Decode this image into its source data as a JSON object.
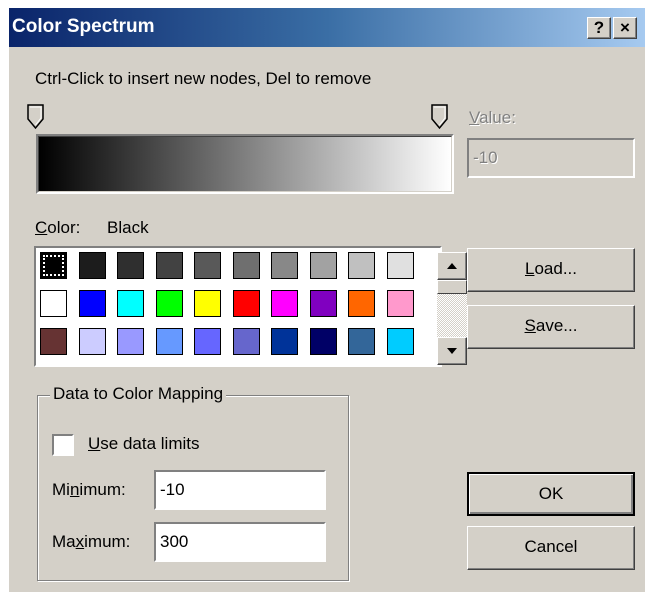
{
  "window": {
    "title": "Color Spectrum",
    "help_button": "?",
    "close_button": "×"
  },
  "instructions": "Ctrl-Click to insert new nodes, Del to remove",
  "gradient": {
    "start_color": "#000000",
    "end_color": "#ffffff"
  },
  "value": {
    "label_pre": "",
    "label_underlined": "V",
    "label_post": "alue:",
    "field_value": "-10"
  },
  "color": {
    "label_underlined": "C",
    "label_post": "olor:",
    "current_value": "Black"
  },
  "palette": [
    [
      "#000000",
      "#1c1c1c",
      "#2f2f2f",
      "#424242",
      "#595959",
      "#6f6f6f",
      "#888888",
      "#a2a2a2",
      "#c0c0c0",
      "#e0e0e0"
    ],
    [
      "#ffffff",
      "#0000ff",
      "#00ffff",
      "#00ff00",
      "#ffff00",
      "#ff0000",
      "#ff00ff",
      "#8000c0",
      "#ff6600",
      "#ff99cc"
    ],
    [
      "#663333",
      "#ccccff",
      "#9999ff",
      "#6699ff",
      "#6666ff",
      "#6666cc",
      "#003399",
      "#000066",
      "#336699",
      "#00ccff"
    ]
  ],
  "selected_swatch": "#000000",
  "buttons": {
    "load_underlined": "L",
    "load_post": "oad...",
    "save_underlined": "S",
    "save_post": "ave...",
    "ok": "OK",
    "cancel": "Cancel"
  },
  "mapping": {
    "group_title": "Data to Color Mapping",
    "use_limits_underlined": "U",
    "use_limits_post": "se data limits",
    "use_limits_checked": false,
    "minimum_pre": "Mi",
    "minimum_underlined": "n",
    "minimum_post": "imum:",
    "minimum_value": "-10",
    "maximum_pre": "Ma",
    "maximum_underlined": "x",
    "maximum_post": "imum:",
    "maximum_value": "300"
  }
}
